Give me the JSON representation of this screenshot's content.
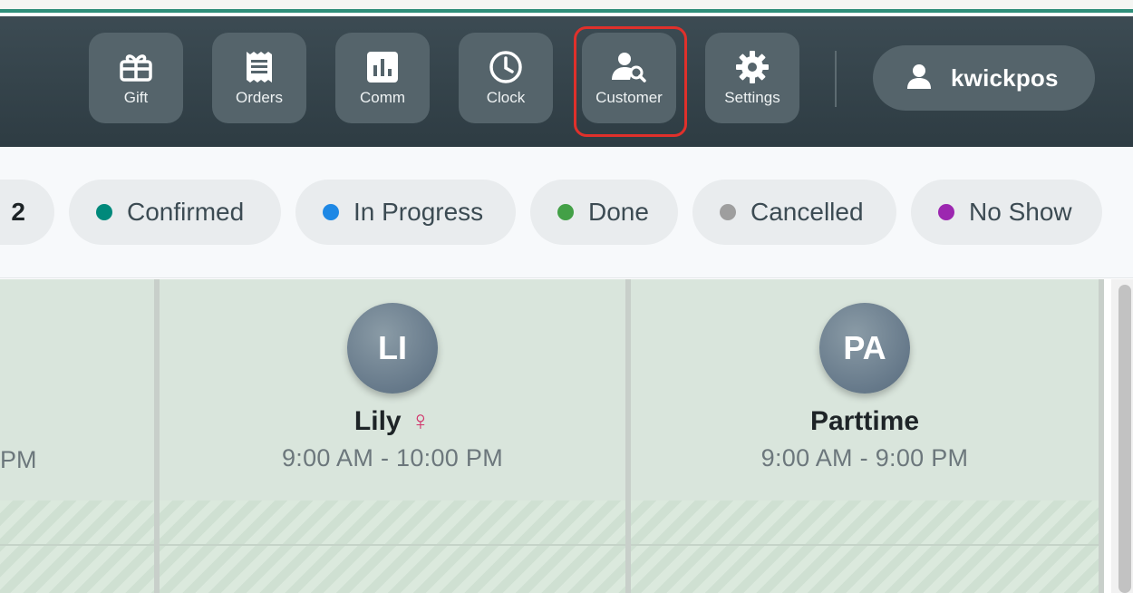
{
  "toolbar": {
    "buttons": [
      {
        "label": "Gift",
        "icon": "gift-icon"
      },
      {
        "label": "Orders",
        "icon": "receipt-icon"
      },
      {
        "label": "Comm",
        "icon": "bar-chart-icon"
      },
      {
        "label": "Clock",
        "icon": "clock-icon"
      },
      {
        "label": "Customer",
        "icon": "user-search-icon"
      },
      {
        "label": "Settings",
        "icon": "gear-icon"
      }
    ],
    "highlighted_button": "Customer",
    "user": {
      "name": "kwickpos",
      "icon": "user-icon"
    }
  },
  "status_filters": {
    "count_label": "2",
    "chips": [
      {
        "label": "Confirmed",
        "color": "#00897b"
      },
      {
        "label": "In Progress",
        "color": "#1e88e5"
      },
      {
        "label": "Done",
        "color": "#43a047"
      },
      {
        "label": "Cancelled",
        "color": "#9e9e9e"
      },
      {
        "label": "No Show",
        "color": "#9c27b0"
      }
    ]
  },
  "staff": {
    "partial_column": {
      "hours_fragment": "PM"
    },
    "columns": [
      {
        "initials": "LI",
        "name": "Lily",
        "gender_symbol": "♀",
        "hours": "9:00 AM - 10:00 PM"
      },
      {
        "initials": "PA",
        "name": "Parttime",
        "gender_symbol": "",
        "hours": "9:00 AM - 9:00 PM"
      }
    ]
  },
  "colors": {
    "toolbar_bg": "#33424a",
    "button_bg": "#55646b",
    "highlight_border": "#e0302b",
    "column_bg": "#d9e5dc"
  }
}
